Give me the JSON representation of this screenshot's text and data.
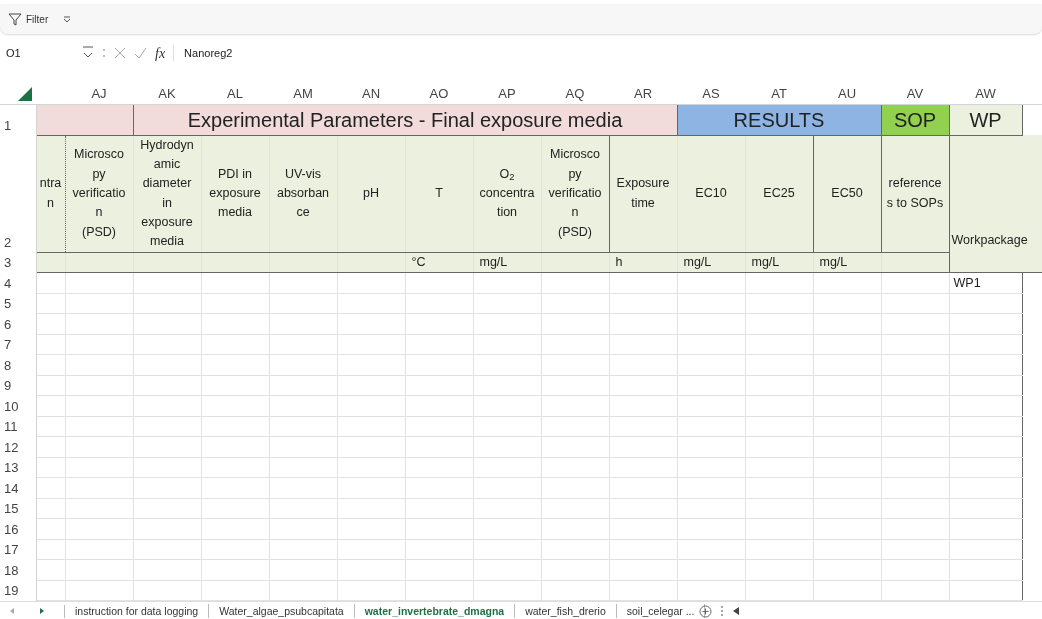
{
  "filter_bar": {
    "label": "Filter"
  },
  "formula_bar": {
    "name_box": "O1",
    "function_label": "fx",
    "formula": "Nanoreg2"
  },
  "sheet": {
    "groups": [
      {
        "color": "#f2dcdb"
      },
      {
        "text": "Experimental Parameters - Final exposure media",
        "color": "#f2dcdb"
      },
      {
        "text": "RESULTS",
        "color": "#8db4e2"
      },
      {
        "text": "SOP",
        "color": "#92d050"
      },
      {
        "text": "WP",
        "color": "#ebf1de"
      }
    ],
    "columns": [
      {
        "header": "ntra\nn"
      },
      {
        "letter": "AJ",
        "header": "Microsco\npy\nverificatio\nn\n(PSD)"
      },
      {
        "letter": "AK",
        "header": "Hydrodyn\namic\ndiameter\nin\nexposure\nmedia"
      },
      {
        "letter": "AL",
        "header": "PDI in\nexposure\nmedia"
      },
      {
        "letter": "AM",
        "header": "UV-vis\nabsorban\nce"
      },
      {
        "letter": "AN",
        "header": "pH"
      },
      {
        "letter": "AO",
        "header": "T",
        "unit": "°C"
      },
      {
        "letter": "AP",
        "header": "O$_{2}$\nconcentra\ntion",
        "unit": "mg/L"
      },
      {
        "letter": "AQ",
        "header": "Microsco\npy\nverificatio\nn\n(PSD)"
      },
      {
        "letter": "AR",
        "header": "Exposure\ntime",
        "unit": "h"
      },
      {
        "letter": "AS",
        "header": "EC10",
        "unit": "mg/L"
      },
      {
        "letter": "AT",
        "header": "EC25",
        "unit": "mg/L"
      },
      {
        "letter": "AU",
        "header": "EC50",
        "unit": "mg/L"
      },
      {
        "letter": "AV",
        "header": "reference\ns to SOPs"
      },
      {
        "letter": "AW",
        "header": "Workpackage"
      }
    ],
    "header_numbers": [
      "1",
      "2",
      "3"
    ],
    "rows": [
      {
        "number": "4",
        "workpackage": "WP1"
      },
      {
        "number": "5"
      },
      {
        "number": "6"
      },
      {
        "number": "7"
      },
      {
        "number": "8"
      },
      {
        "number": "9"
      },
      {
        "number": "10"
      },
      {
        "number": "11"
      },
      {
        "number": "12"
      },
      {
        "number": "13"
      },
      {
        "number": "14"
      },
      {
        "number": "15"
      },
      {
        "number": "16"
      },
      {
        "number": "17"
      },
      {
        "number": "18"
      },
      {
        "number": "19"
      }
    ]
  },
  "sheet_tabs": [
    {
      "label": "instruction for data logging",
      "selected": false
    },
    {
      "label": "Water_algae_psubcapitata",
      "selected": false
    },
    {
      "label": "water_invertebrate_dmagna",
      "selected": true
    },
    {
      "label": "water_fish_drerio",
      "selected": false
    },
    {
      "label": "soil_celegar ...",
      "selected": false
    }
  ]
}
